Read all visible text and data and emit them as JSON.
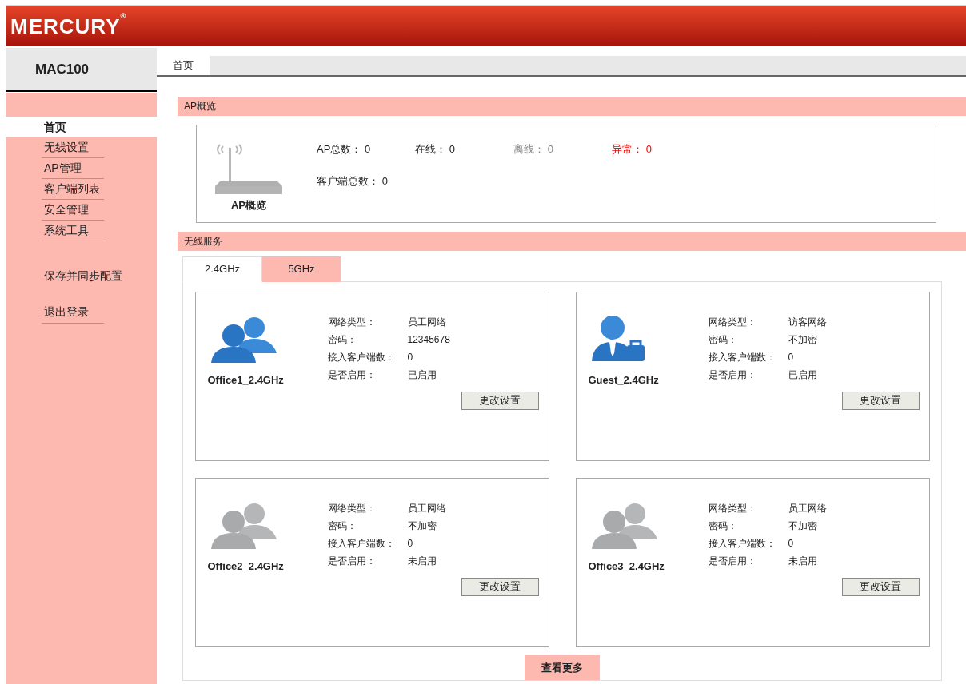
{
  "header": {
    "logo": "MERCURY",
    "logo_mark": "®"
  },
  "sidebar": {
    "device": "MAC100",
    "items": [
      {
        "label": "首页",
        "selected": true
      },
      {
        "label": "无线设置",
        "selected": false
      },
      {
        "label": "AP管理",
        "selected": false
      },
      {
        "label": "客户端列表",
        "selected": false
      },
      {
        "label": "安全管理",
        "selected": false
      },
      {
        "label": "系统工具",
        "selected": false
      }
    ],
    "actions": [
      {
        "label": "保存并同步配置",
        "kind": "plain"
      },
      {
        "label": "退出登录",
        "kind": "underlined"
      }
    ]
  },
  "page_tabs": [
    {
      "label": "首页",
      "selected": true
    }
  ],
  "ap_overview": {
    "title": "AP概览",
    "icon_label": "AP概览",
    "stats": [
      {
        "label": "AP总数：",
        "value": "0",
        "kind": "normal"
      },
      {
        "label": "在线：",
        "value": "0",
        "kind": "normal"
      },
      {
        "label": "离线：",
        "value": "0",
        "kind": "muted"
      },
      {
        "label": "异常：",
        "value": "0",
        "kind": "alert"
      }
    ],
    "clients": {
      "label": "客户端总数：",
      "value": "0"
    }
  },
  "wireless": {
    "title": "无线服务",
    "tabs": [
      {
        "label": "2.4GHz",
        "selected": true
      },
      {
        "label": "5GHz",
        "selected": false
      }
    ],
    "cards": [
      {
        "name": "Office1_2.4GHz",
        "kind": "staff",
        "active": true,
        "fields": [
          {
            "label": "网络类型：",
            "value": "员工网络"
          },
          {
            "label": "密码：",
            "value": "12345678"
          },
          {
            "label": "接入客户端数：",
            "value": "0"
          },
          {
            "label": "是否启用：",
            "value": "已启用"
          }
        ],
        "button": "更改设置"
      },
      {
        "name": "Guest_2.4GHz",
        "kind": "guest",
        "active": true,
        "fields": [
          {
            "label": "网络类型：",
            "value": "访客网络"
          },
          {
            "label": "密码：",
            "value": "不加密"
          },
          {
            "label": "接入客户端数：",
            "value": "0"
          },
          {
            "label": "是否启用：",
            "value": "已启用"
          }
        ],
        "button": "更改设置"
      },
      {
        "name": "Office2_2.4GHz",
        "kind": "staff",
        "active": false,
        "fields": [
          {
            "label": "网络类型：",
            "value": "员工网络"
          },
          {
            "label": "密码：",
            "value": "不加密"
          },
          {
            "label": "接入客户端数：",
            "value": "0"
          },
          {
            "label": "是否启用：",
            "value": "未启用"
          }
        ],
        "button": "更改设置"
      },
      {
        "name": "Office3_2.4GHz",
        "kind": "staff",
        "active": false,
        "fields": [
          {
            "label": "网络类型：",
            "value": "员工网络"
          },
          {
            "label": "密码：",
            "value": "不加密"
          },
          {
            "label": "接入客户端数：",
            "value": "0"
          },
          {
            "label": "是否启用：",
            "value": "未启用"
          }
        ],
        "button": "更改设置"
      }
    ],
    "more_button": "查看更多"
  }
}
